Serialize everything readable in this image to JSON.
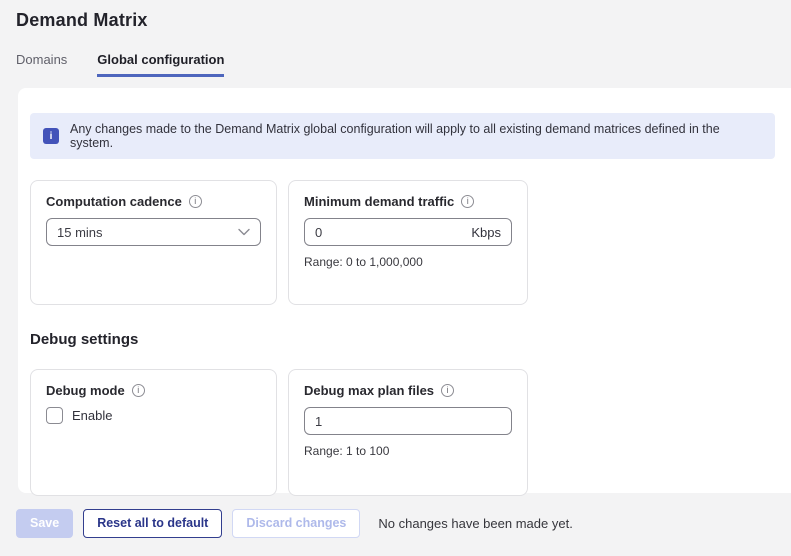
{
  "page": {
    "title": "Demand Matrix"
  },
  "tabs": [
    {
      "label": "Domains",
      "active": false
    },
    {
      "label": "Global configuration",
      "active": true
    }
  ],
  "banner": {
    "icon": "info-icon",
    "icon_glyph": "i",
    "text": "Any changes made to the Demand Matrix global configuration will apply to all existing demand matrices defined in the system."
  },
  "icons": {
    "info_glyph": "i"
  },
  "cards": {
    "computation_cadence": {
      "label": "Computation cadence",
      "value": "15 mins"
    },
    "minimum_demand_traffic": {
      "label": "Minimum demand traffic",
      "value": "0",
      "unit": "Kbps",
      "range": "Range: 0 to 1,000,000"
    },
    "debug_mode": {
      "label": "Debug mode",
      "checkbox_label": "Enable",
      "checked": false
    },
    "debug_max_plan_files": {
      "label": "Debug max plan files",
      "value": "1",
      "range": "Range: 1 to 100"
    }
  },
  "sections": {
    "debug": {
      "heading": "Debug settings"
    }
  },
  "footer": {
    "save_label": "Save",
    "reset_label": "Reset all to default",
    "discard_label": "Discard changes",
    "status": "No changes have been made yet."
  },
  "colors": {
    "accent": "#4e66bd",
    "banner_bg": "#e8ecfa",
    "banner_icon_bg": "#4353b9",
    "save_disabled_bg": "#c4ccf0",
    "reset_border": "#323e8e",
    "page_bg": "#f3f3f4",
    "card_border": "#e1e1e4"
  }
}
